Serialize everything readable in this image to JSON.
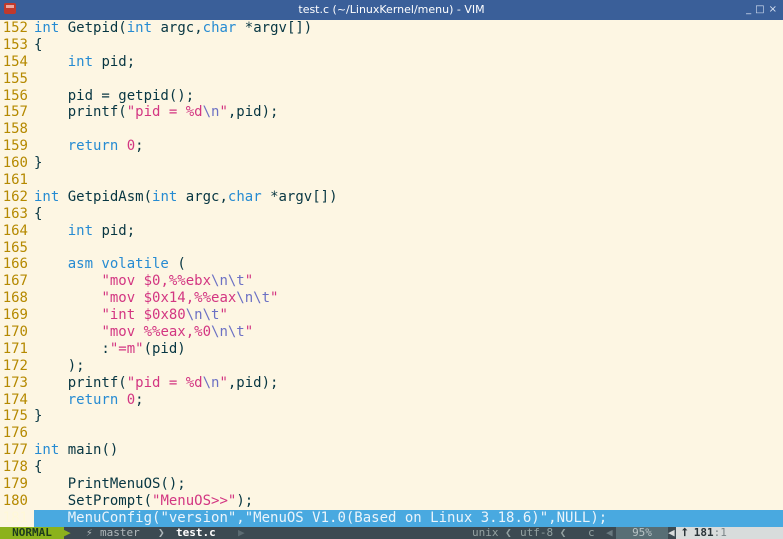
{
  "window": {
    "title": "test.c (~/LinuxKernel/menu) - VIM",
    "buttons": [
      "_",
      "□",
      "×"
    ]
  },
  "editor": {
    "lines": [
      {
        "n": "152",
        "t": [
          [
            "kw",
            "int"
          ],
          [
            "",
            "Getpid("
          ],
          [
            "kw",
            "int"
          ],
          [
            "",
            "argc,"
          ],
          [
            "kw",
            "char"
          ],
          [
            "",
            "*argv[])"
          ]
        ]
      },
      {
        "n": "153",
        "t": [
          [
            "",
            "{"
          ]
        ]
      },
      {
        "n": "154",
        "t": [
          [
            "",
            "    "
          ],
          [
            "kw",
            "int"
          ],
          [
            "",
            "pid;"
          ]
        ]
      },
      {
        "n": "155",
        "t": []
      },
      {
        "n": "156",
        "t": [
          [
            "",
            "    pid = getpid();"
          ]
        ]
      },
      {
        "n": "157",
        "t": [
          [
            "",
            "    printf("
          ],
          [
            "str",
            "\"pid = %d"
          ],
          [
            "esc",
            "\\n"
          ],
          [
            "str",
            "\""
          ],
          [
            "",
            ",pid);"
          ]
        ]
      },
      {
        "n": "158",
        "t": []
      },
      {
        "n": "159",
        "t": [
          [
            "",
            "    "
          ],
          [
            "kw",
            "return"
          ],
          [
            "num",
            "0"
          ],
          [
            "",
            ";"
          ]
        ]
      },
      {
        "n": "160",
        "t": [
          [
            "",
            "}"
          ]
        ]
      },
      {
        "n": "161",
        "t": []
      },
      {
        "n": "162",
        "t": [
          [
            "kw",
            "int"
          ],
          [
            "",
            "GetpidAsm("
          ],
          [
            "kw",
            "int"
          ],
          [
            "",
            "argc,"
          ],
          [
            "kw",
            "char"
          ],
          [
            "",
            "*argv[])"
          ]
        ]
      },
      {
        "n": "163",
        "t": [
          [
            "",
            "{"
          ]
        ]
      },
      {
        "n": "164",
        "t": [
          [
            "",
            "    "
          ],
          [
            "kw",
            "int"
          ],
          [
            "",
            "pid;"
          ]
        ]
      },
      {
        "n": "165",
        "t": []
      },
      {
        "n": "166",
        "t": [
          [
            "",
            "    "
          ],
          [
            "kw",
            "asm volatile"
          ],
          [
            "",
            "("
          ]
        ]
      },
      {
        "n": "167",
        "t": [
          [
            "",
            "        "
          ],
          [
            "str",
            "\"mov $0,%%ebx"
          ],
          [
            "esc",
            "\\n\\t"
          ],
          [
            "str",
            "\""
          ]
        ]
      },
      {
        "n": "168",
        "t": [
          [
            "",
            "        "
          ],
          [
            "str",
            "\"mov $0x14,%%eax"
          ],
          [
            "esc",
            "\\n\\t"
          ],
          [
            "str",
            "\""
          ]
        ]
      },
      {
        "n": "169",
        "t": [
          [
            "",
            "        "
          ],
          [
            "str",
            "\"int $0x80"
          ],
          [
            "esc",
            "\\n\\t"
          ],
          [
            "str",
            "\""
          ]
        ]
      },
      {
        "n": "170",
        "t": [
          [
            "",
            "        "
          ],
          [
            "str",
            "\"mov %%eax,%0"
          ],
          [
            "esc",
            "\\n\\t"
          ],
          [
            "str",
            "\""
          ]
        ]
      },
      {
        "n": "171",
        "t": [
          [
            "",
            "        :"
          ],
          [
            "str",
            "\"=m\""
          ],
          [
            "",
            "(pid)"
          ]
        ]
      },
      {
        "n": "172",
        "t": [
          [
            "",
            "    );"
          ]
        ]
      },
      {
        "n": "173",
        "t": [
          [
            "",
            "    printf("
          ],
          [
            "str",
            "\"pid = %d"
          ],
          [
            "esc",
            "\\n"
          ],
          [
            "str",
            "\""
          ],
          [
            "",
            ",pid);"
          ]
        ]
      },
      {
        "n": "174",
        "t": [
          [
            "",
            "    "
          ],
          [
            "kw",
            "return"
          ],
          [
            "num",
            "0"
          ],
          [
            "",
            ";"
          ]
        ]
      },
      {
        "n": "175",
        "t": [
          [
            "",
            "}"
          ]
        ]
      },
      {
        "n": "176",
        "t": []
      },
      {
        "n": "177",
        "t": [
          [
            "kw",
            "int"
          ],
          [
            "",
            "main()"
          ]
        ]
      },
      {
        "n": "178",
        "t": [
          [
            "",
            "{"
          ]
        ]
      },
      {
        "n": "179",
        "t": [
          [
            "",
            "    PrintMenuOS();"
          ]
        ]
      },
      {
        "n": "180",
        "t": [
          [
            "",
            "    SetPrompt("
          ],
          [
            "str",
            "\"MenuOS>>\""
          ],
          [
            "",
            ");"
          ]
        ]
      },
      {
        "n": "181",
        "t": [
          [
            "",
            "    MenuConfig("
          ],
          [
            "str",
            "\"version\""
          ],
          [
            "",
            ","
          ],
          [
            "str",
            "\"MenuOS V1.0(Based on Linux 3.18.6)\""
          ],
          [
            "",
            ",NULL);"
          ]
        ],
        "current": true
      }
    ]
  },
  "status": {
    "mode": "NORMAL",
    "mode_sep": "▶",
    "branch_icon": "⚡",
    "branch": "master",
    "sep1": "❯",
    "filename": "test.c",
    "sep2": "▶",
    "fileformat": "unix ❮",
    "encoding": "utf-8 ❮",
    "filetype": "c",
    "pct_sep": "◀",
    "percent": "95%",
    "pos_sep": "◀",
    "line_icon": "⭡",
    "row": "181",
    "col": ":1"
  },
  "colors": {
    "background": "#fdf6e3",
    "linenumber": "#b58900",
    "keyword": "#268bd2",
    "string": "#d33682",
    "escape": "#6c71c4",
    "cursorline": "#49a9e0",
    "mode_bg": "#8cb21c",
    "titlebar": "#3a5f99"
  }
}
